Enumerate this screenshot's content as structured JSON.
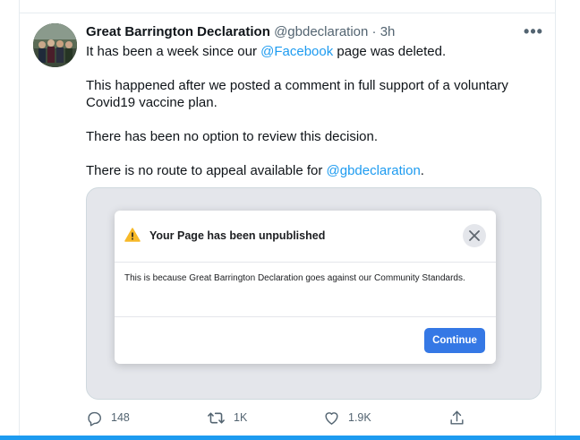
{
  "tweet": {
    "author_name": "Great Barrington Declaration",
    "author_handle": "@gbdeclaration",
    "separator": "·",
    "time": "3h",
    "more_label": "•••",
    "line1_pre": "It has been a week since our ",
    "line1_link": "@Facebook",
    "line1_post": " page was deleted.",
    "line2": "This happened after we posted a comment in full support of a voluntary Covid19 vaccine plan.",
    "line3": "There has been no option to review this decision.",
    "line4_pre": "There is no route to appeal available for ",
    "line4_link": "@gbdeclaration",
    "line4_post": "."
  },
  "media": {
    "dialog_title": "Your Page has been unpublished",
    "dialog_body": "This is because Great Barrington Declaration goes against our Community Standards.",
    "continue_label": "Continue"
  },
  "actions": {
    "replies": "148",
    "retweets": "1K",
    "likes": "1.9K"
  },
  "colors": {
    "link": "#1d9bf0",
    "fb_button": "#3578e5",
    "warning": "#f7b928",
    "bottom_bar": "#1d9bf0"
  },
  "icons": [
    "warning-icon",
    "close-icon",
    "reply-icon",
    "retweet-icon",
    "like-icon",
    "share-icon",
    "more-icon"
  ]
}
